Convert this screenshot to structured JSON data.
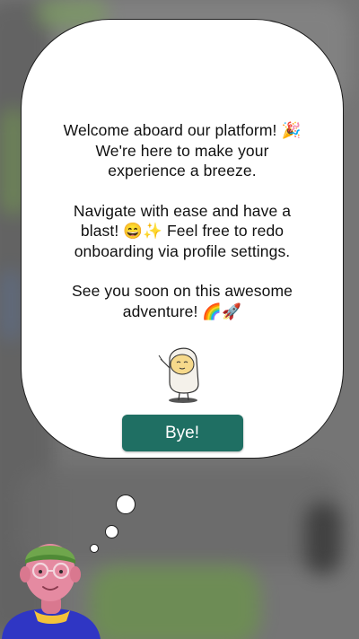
{
  "dialog": {
    "paragraph1_line1": "Welcome aboard our platform! 🎉",
    "paragraph1_line2": "We're here to make your",
    "paragraph1_line3": "experience a breeze.",
    "paragraph2_line1": "Navigate with ease and have a",
    "paragraph2_line2": "blast! 😄✨ Feel free to redo",
    "paragraph2_line3": "onboarding via profile settings.",
    "paragraph3_line1": "See you soon on this awesome",
    "paragraph3_line2": "adventure! 🌈🚀",
    "bye_label": "Bye!",
    "mascot_icon": "waving-mascot-icon",
    "avatar_icon": "user-avatar-3d",
    "button_color": "#1f6f63"
  }
}
